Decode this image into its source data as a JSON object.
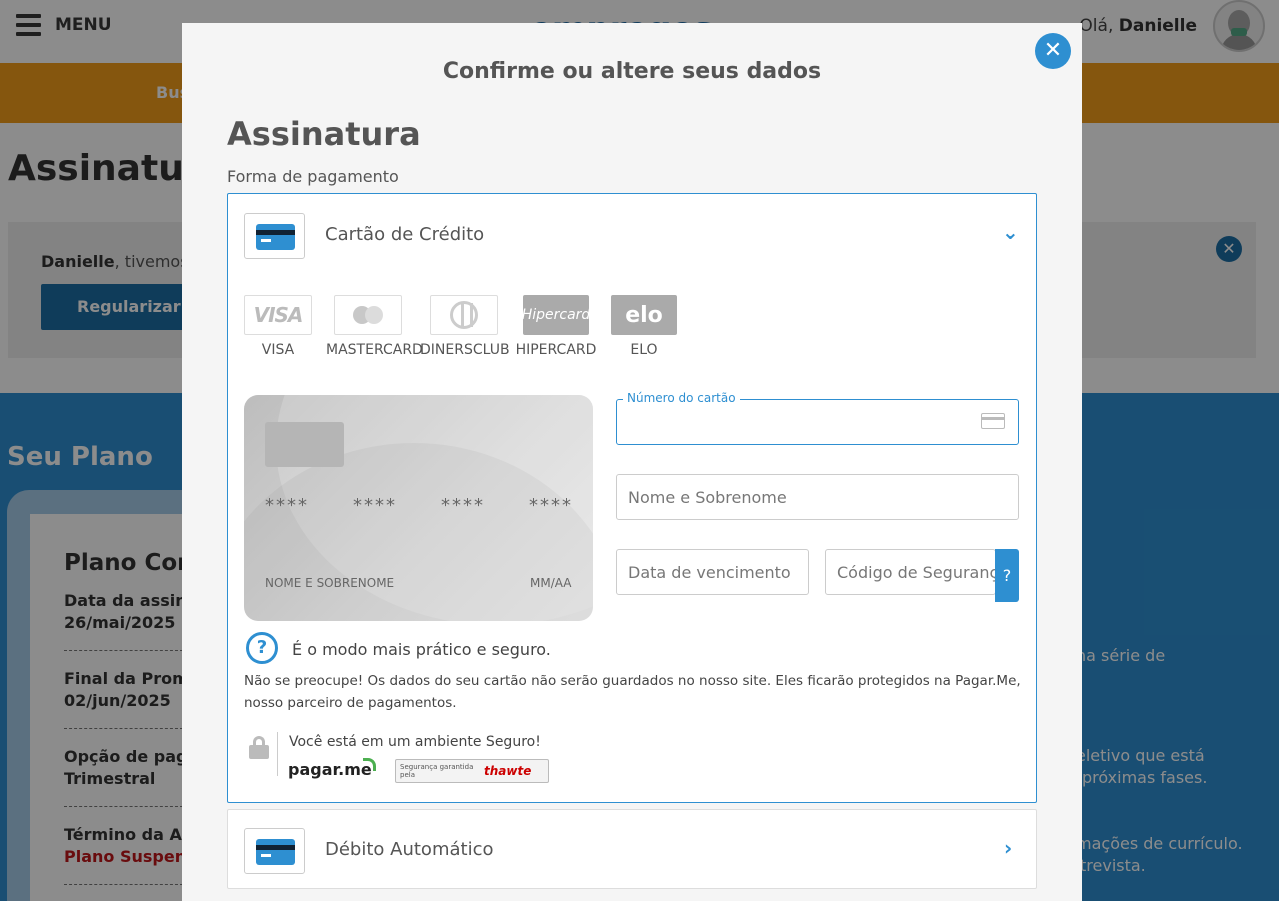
{
  "header": {
    "menu_label": "MENU",
    "logo_text": "empregos",
    "greeting_prefix": "Olá, ",
    "user_name": "Danielle"
  },
  "nav": {
    "first_item": "Bus"
  },
  "page": {
    "title": "Assinatura"
  },
  "notice": {
    "user_name": "Danielle",
    "text": ", tivemos p",
    "button_label": "Regularizar as"
  },
  "plan": {
    "section_title": "Seu Plano",
    "name": "Plano Com",
    "rows": [
      {
        "label": "Data da assinat",
        "value": "26/mai/2025"
      },
      {
        "label": "Final da Promo",
        "value": "02/jun/2025"
      },
      {
        "label": "Opção de pagam",
        "value": "Trimestral"
      },
      {
        "label": "Término da Ass",
        "value": "Plano Suspenso"
      }
    ]
  },
  "right_snippets": [
    "na série de",
    "eletivo que está",
    "próximas fases.",
    "mações de currículo.",
    "trevista."
  ],
  "modal": {
    "title": "Confirme ou altere seus dados",
    "section_title": "Assinatura",
    "payment_label": "Forma de pagamento",
    "credit": {
      "label": "Cartão de Crédito",
      "brands": [
        "VISA",
        "MASTERCARD",
        "DINERSCLUB",
        "HIPERCARD",
        "ELO"
      ],
      "brand_logo_text": {
        "visa": "VISA",
        "hiper": "Hipercard",
        "elo": "elo"
      },
      "card_preview": {
        "group": "****",
        "holder": "NOME E SOBRENOME",
        "expiry": "MM/AA"
      },
      "fields": {
        "number_label": "Número do cartão",
        "number_value": "",
        "name_placeholder": "Nome e Sobrenome",
        "expiry_placeholder": "Data de vencimento",
        "cvv_placeholder": "Código de Segurança",
        "help": "?"
      },
      "secure_heading": "É o modo mais prático e seguro.",
      "secure_body": "Não se preocupe! Os dados do seu cartão não serão guardados no nosso site. Eles ficarão protegidos na Pagar.Me, nosso parceiro de pagamentos.",
      "safe_env": "Você está em um ambiente Seguro!",
      "pagarme": "pagar.me",
      "thawte_small": "Segurança garantida pela",
      "thawte_brand": "thawte"
    },
    "debit": {
      "label": "Débito Automático"
    }
  },
  "colors": {
    "accent": "#2e8fd1",
    "orange": "#f29d1b",
    "dark_blue": "#1c6ea4",
    "alert_red": "#c0161b"
  }
}
